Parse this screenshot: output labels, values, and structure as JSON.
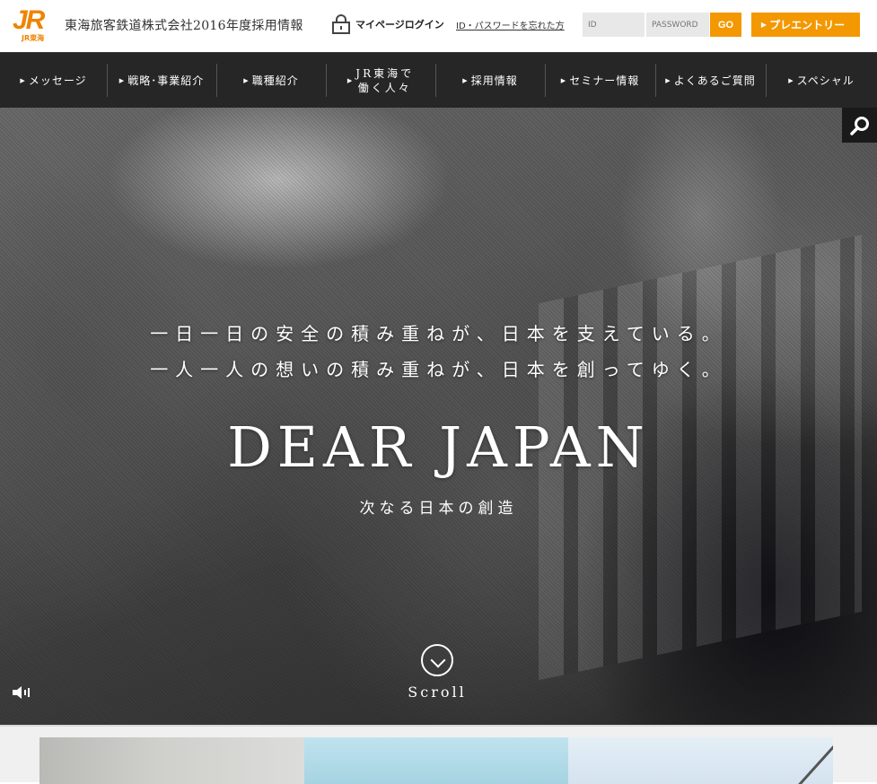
{
  "brand": {
    "logo_text": "JR",
    "logo_sub": "JR東海",
    "site_title": "東海旅客鉄道株式会社2016年度採用情報",
    "accent_color": "#f39800"
  },
  "account": {
    "mypage_label": "マイページログイン",
    "forgot_link": "ID・パスワードを忘れた方",
    "id_placeholder": "ID",
    "password_placeholder": "PASSWORD",
    "go_label": "GO",
    "entry_label": "プレエントリー"
  },
  "nav": {
    "items": [
      {
        "label": "メッセージ"
      },
      {
        "label": "戦略･事業紹介"
      },
      {
        "label": "職種紹介"
      },
      {
        "label": "JR東海で\n働く人々"
      },
      {
        "label": "採用情報"
      },
      {
        "label": "セミナー情報"
      },
      {
        "label": "よくあるご質問"
      },
      {
        "label": "スペシャル"
      }
    ]
  },
  "hero": {
    "line1": "一日一日の安全の積み重ねが、日本を支えている。",
    "line2": "一人一人の想いの積み重ねが、日本を創ってゆく。",
    "title": "DEAR JAPAN",
    "subtitle": "次なる日本の創造",
    "scroll_label": "Scroll"
  },
  "icons": {
    "search": "search-icon",
    "sound": "speaker-icon",
    "lock": "lock-icon",
    "scroll": "chevron-down-circle-icon"
  }
}
